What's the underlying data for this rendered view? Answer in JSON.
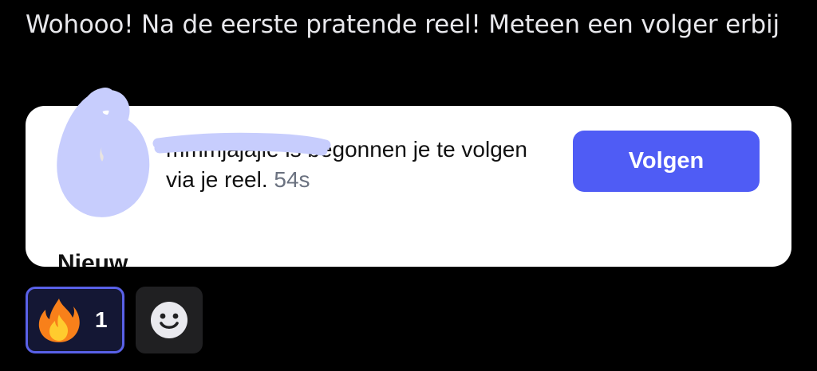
{
  "message": {
    "text": "Wohooo! Na de eerste pratende reel! Meteen een volger erbij"
  },
  "notification": {
    "username": "mmmjajajie",
    "body": " is begonnen je te volgen via je reel. ",
    "time": "54s",
    "follow_label": "Volgen",
    "section_heading": "Nieuw"
  },
  "reactions": [
    {
      "icon": "fire-emoji-icon",
      "count": "1"
    },
    {
      "icon": "add-reaction-smiley-icon"
    }
  ],
  "colors": {
    "background": "#000000",
    "follow_button": "#4f5cf5",
    "selected_reaction_border": "#5961e8",
    "redaction_scribble": "#c7cdfd"
  }
}
